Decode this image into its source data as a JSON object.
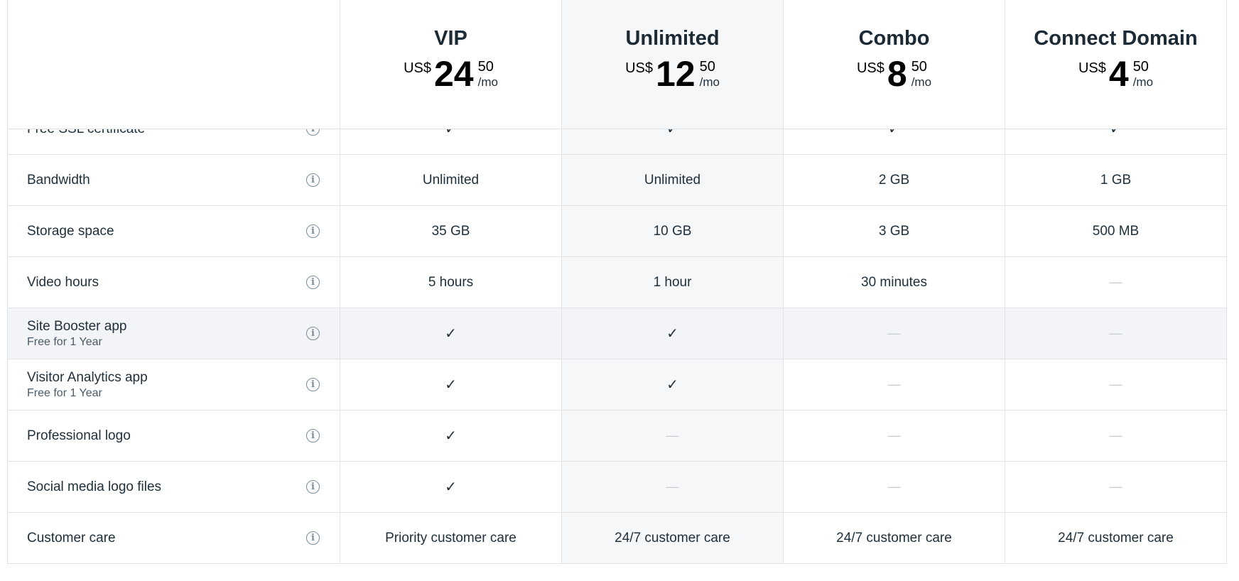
{
  "plans": [
    {
      "name": "VIP",
      "currency": "US$",
      "whole": "24",
      "cents": "50",
      "period": "/mo"
    },
    {
      "name": "Unlimited",
      "currency": "US$",
      "whole": "12",
      "cents": "50",
      "period": "/mo"
    },
    {
      "name": "Combo",
      "currency": "US$",
      "whole": "8",
      "cents": "50",
      "period": "/mo"
    },
    {
      "name": "Connect Domain",
      "currency": "US$",
      "whole": "4",
      "cents": "50",
      "period": "/mo"
    }
  ],
  "highlighted_plan": "Unlimited",
  "rows": [
    {
      "label": "Free SSL certificate",
      "sub": "",
      "values": [
        "check",
        "check",
        "check",
        "check"
      ]
    },
    {
      "label": "Bandwidth",
      "sub": "",
      "values": [
        "Unlimited",
        "Unlimited",
        "2 GB",
        "1 GB"
      ]
    },
    {
      "label": "Storage space",
      "sub": "",
      "values": [
        "35 GB",
        "10 GB",
        "3 GB",
        "500 MB"
      ]
    },
    {
      "label": "Video hours",
      "sub": "",
      "values": [
        "5 hours",
        "1 hour",
        "30 minutes",
        "dash"
      ]
    },
    {
      "label": "Site Booster app",
      "sub": "Free for 1 Year",
      "values": [
        "check",
        "check",
        "dash",
        "dash"
      ]
    },
    {
      "label": "Visitor Analytics app",
      "sub": "Free for 1 Year",
      "values": [
        "check",
        "check",
        "dash",
        "dash"
      ]
    },
    {
      "label": "Professional logo",
      "sub": "",
      "values": [
        "check",
        "dash",
        "dash",
        "dash"
      ]
    },
    {
      "label": "Social media logo files",
      "sub": "",
      "values": [
        "check",
        "dash",
        "dash",
        "dash"
      ]
    },
    {
      "label": "Customer care",
      "sub": "",
      "values": [
        "Priority customer care",
        "24/7 customer care",
        "24/7 customer care",
        "24/7 customer care"
      ]
    }
  ],
  "icons": {
    "info": "info-circle-icon",
    "check": "checkmark-icon",
    "dash": "dash-icon"
  },
  "symbols": {
    "check": "✓",
    "dash": "—",
    "info": "i"
  },
  "colors": {
    "highlight_column": "#f6f7f9",
    "hover_row": "#f2f4f7",
    "border": "#dfe3e8"
  }
}
